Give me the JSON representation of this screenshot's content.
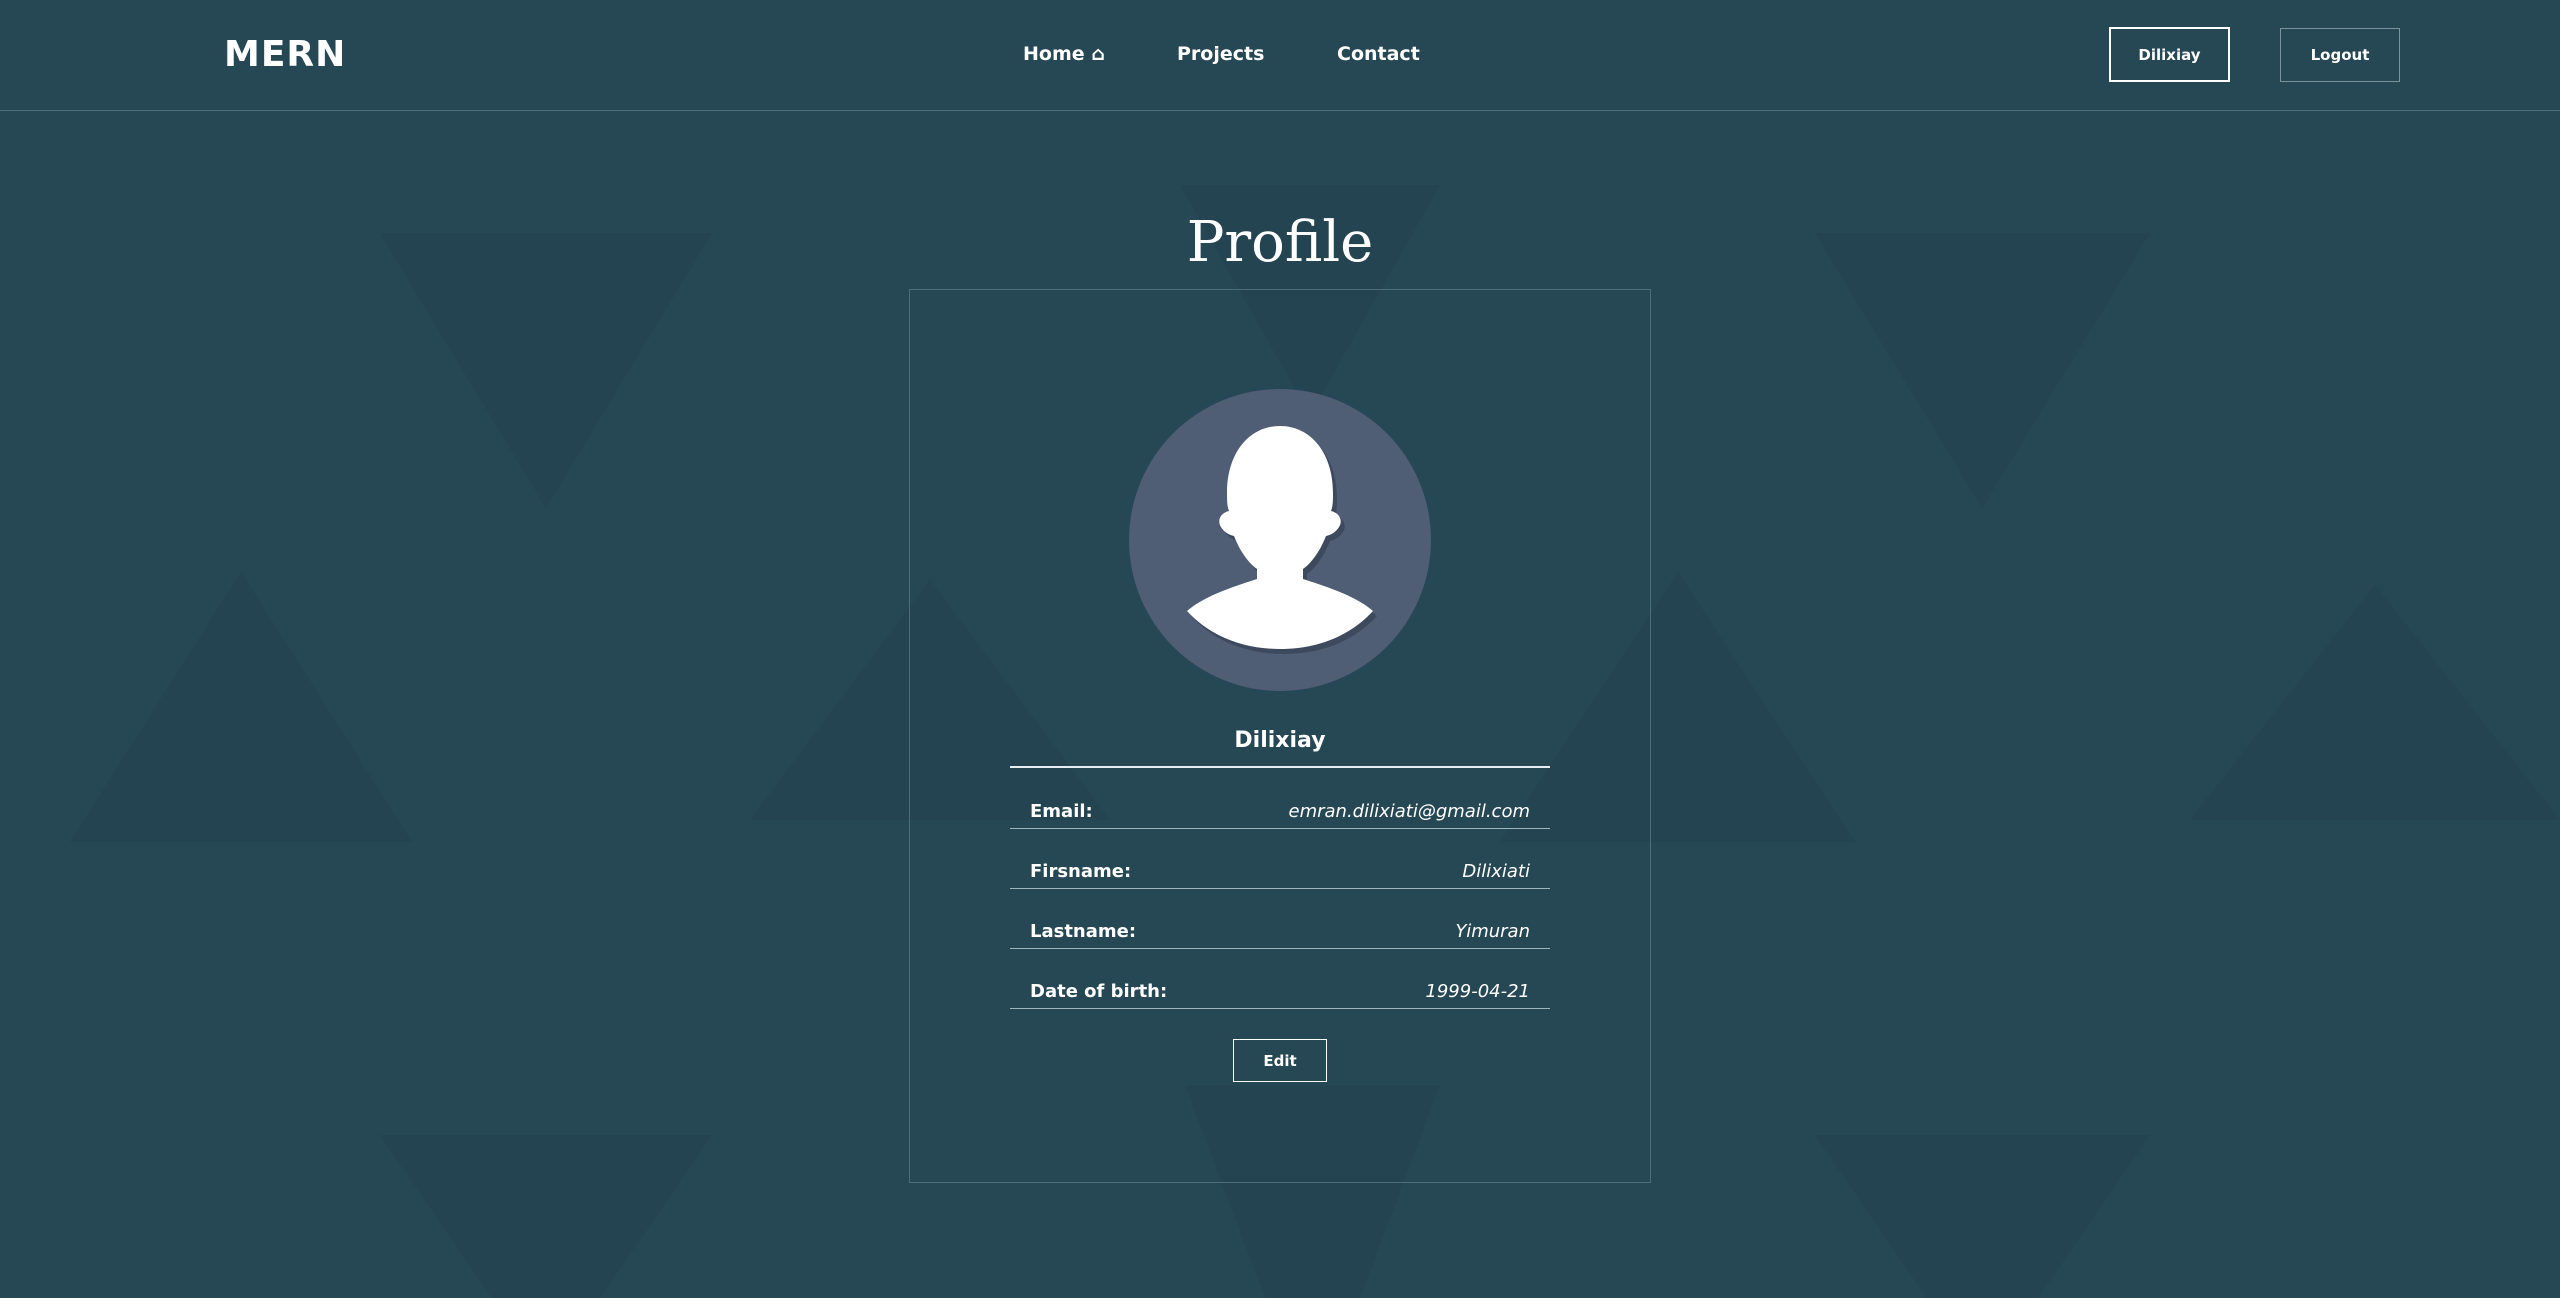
{
  "navbar": {
    "brand": "MERN",
    "links": [
      {
        "label": "Home ⌂"
      },
      {
        "label": "Projects"
      },
      {
        "label": "Contact"
      }
    ],
    "user_button": "Dilixiay",
    "logout_button": "Logout"
  },
  "profile": {
    "title": "Profile",
    "username": "Dilixiay",
    "fields": [
      {
        "label": "Email:",
        "value": "emran.dilixiati@gmail.com"
      },
      {
        "label": "Firsname:",
        "value": "Dilixiati"
      },
      {
        "label": "Lastname:",
        "value": "Yimuran"
      },
      {
        "label": "Date of birth:",
        "value": "1999-04-21"
      }
    ],
    "edit_button": "Edit"
  },
  "colors": {
    "background": "#264754",
    "triangle": "#234450",
    "avatar_circle": "#4f5d75",
    "text": "#ffffff"
  },
  "icons": {
    "avatar": "user-silhouette-icon"
  }
}
